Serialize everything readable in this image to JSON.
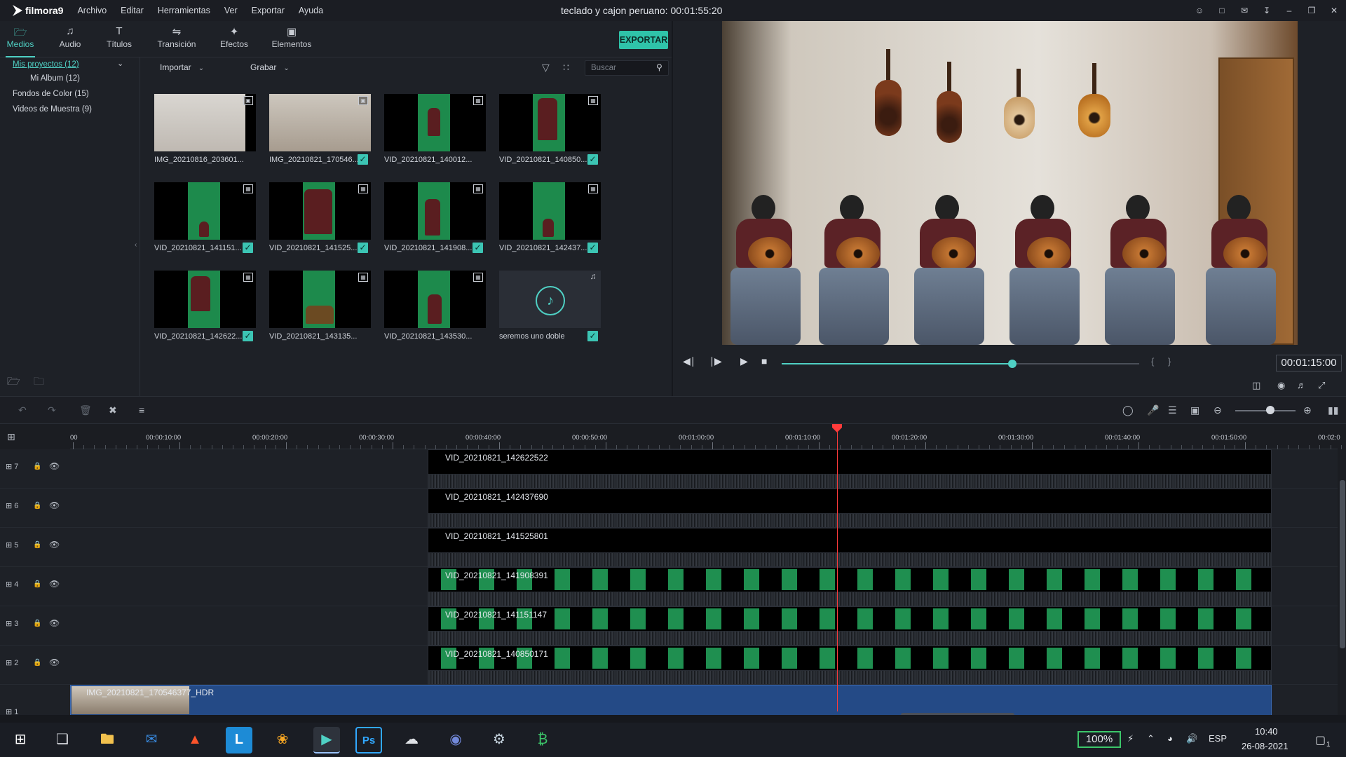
{
  "app": {
    "logo_text": "filmora9",
    "menu": [
      "Archivo",
      "Editar",
      "Herramientas",
      "Ver",
      "Exportar",
      "Ayuda"
    ],
    "project_title": "teclado y cajon peruano:  00:01:55:20"
  },
  "media_tabs": [
    {
      "label": "Medios",
      "icon": "folder-icon",
      "active": true
    },
    {
      "label": "Audio",
      "icon": "music-note-icon",
      "active": false
    },
    {
      "label": "Títulos",
      "icon": "text-icon",
      "active": false
    },
    {
      "label": "Transición",
      "icon": "transition-icon",
      "active": false
    },
    {
      "label": "Efectos",
      "icon": "effects-icon",
      "active": false
    },
    {
      "label": "Elementos",
      "icon": "image-icon",
      "active": false
    }
  ],
  "export_label": "EXPORTAR",
  "sidebar": {
    "projects": "Mis proyectos (12)",
    "album": "Mi Album (12)",
    "fondos": "Fondos de Color (15)",
    "videos": "Videos de Muestra (9)"
  },
  "toolbar": {
    "import_label": "Importar",
    "record_label": "Grabar",
    "search_placeholder": "Buscar"
  },
  "media_items": [
    {
      "name": "IMG_20210816_203601...",
      "type": "image",
      "checked": false
    },
    {
      "name": "IMG_20210821_170546...",
      "type": "image",
      "checked": true
    },
    {
      "name": "VID_20210821_140012...",
      "type": "video",
      "checked": false
    },
    {
      "name": "VID_20210821_140850...",
      "type": "video",
      "checked": true
    },
    {
      "name": "VID_20210821_141151...",
      "type": "video",
      "checked": true
    },
    {
      "name": "VID_20210821_141525...",
      "type": "video",
      "checked": true
    },
    {
      "name": "VID_20210821_141908...",
      "type": "video",
      "checked": true
    },
    {
      "name": "VID_20210821_142437...",
      "type": "video",
      "checked": true
    },
    {
      "name": "VID_20210821_142622...",
      "type": "video",
      "checked": true
    },
    {
      "name": "VID_20210821_143135...",
      "type": "video",
      "checked": false
    },
    {
      "name": "VID_20210821_143530...",
      "type": "video",
      "checked": false
    },
    {
      "name": "seremos uno doble",
      "type": "audio",
      "checked": true
    }
  ],
  "preview": {
    "current_time": "00:01:15:00",
    "progress": 0.645
  },
  "ruler_labels": [
    "00",
    "00:00:10:00",
    "00:00:20:00",
    "00:00:30:00",
    "00:00:40:00",
    "00:00:50:00",
    "00:01:00:00",
    "00:01:10:00",
    "00:01:20:00",
    "00:01:30:00",
    "00:01:40:00",
    "00:01:50:00",
    "00:02:0"
  ],
  "tracks": [
    {
      "number": "7",
      "clip": "VID_20210821_142622522",
      "frames": false
    },
    {
      "number": "6",
      "clip": "VID_20210821_142437690",
      "frames": false
    },
    {
      "number": "5",
      "clip": "VID_20210821_141525801",
      "frames": false
    },
    {
      "number": "4",
      "clip": "VID_20210821_141908391",
      "frames": true
    },
    {
      "number": "3",
      "clip": "VID_20210821_141151147",
      "frames": true
    },
    {
      "number": "2",
      "clip": "VID_20210821_140850171",
      "frames": true
    }
  ],
  "photo_track": {
    "number": "1",
    "clip": "IMG_20210821_170546377_HDR"
  },
  "taskbar": {
    "battery": "100%",
    "language": "ESP",
    "time": "10:40",
    "date": "26-08-2021",
    "notifications": "1",
    "apps": [
      "windows-start-icon",
      "task-view-icon",
      "file-explorer-icon",
      "mail-icon",
      "brave-browser-icon",
      "l-app-icon",
      "fl-studio-icon",
      "filmora-icon",
      "photoshop-icon",
      "cloud-app-icon",
      "discord-icon",
      "steam-icon",
      "bitcoin-app-icon"
    ]
  },
  "colors": {
    "accent": "#4fd0c4",
    "export": "#2fc3a9",
    "playhead": "#ff3b3b"
  }
}
